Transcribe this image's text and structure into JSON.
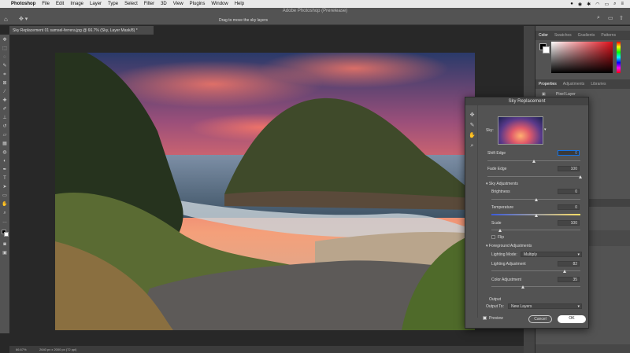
{
  "menubar": {
    "app": "Photoshop",
    "items": [
      "File",
      "Edit",
      "Image",
      "Layer",
      "Type",
      "Select",
      "Filter",
      "3D",
      "View",
      "Plugins",
      "Window",
      "Help"
    ]
  },
  "window": {
    "title": "Adobe Photoshop (Prerelease)",
    "hint": "Drag to move the sky layers"
  },
  "document": {
    "tab": "Sky Replacement 01 samsel-ferrera.jpg @ 66.7% (Sky, Layer Mask/8) *",
    "zoom": "66.67%",
    "size": "2640 px x 2000 px (72 ppi)"
  },
  "panels": {
    "top_tabs": [
      "Color",
      "Swatches",
      "Gradients",
      "Patterns"
    ],
    "mid_tabs": [
      "Properties",
      "Adjustments",
      "Libraries"
    ],
    "pixel_layer": "Pixel Layer"
  },
  "dialog": {
    "title": "Sky Replacement",
    "sky_label": "Sky:",
    "shift_edge": {
      "label": "Shift Edge",
      "value": "0",
      "level": 0.5
    },
    "fade_edge": {
      "label": "Fade Edge",
      "value": "100",
      "level": 1.0
    },
    "sky_adjustments": "Sky Adjustments",
    "brightness": {
      "label": "Brightness",
      "value": "0",
      "level": 0.5
    },
    "temperature": {
      "label": "Temperature",
      "value": "0",
      "level": 0.5
    },
    "scale": {
      "label": "Scale",
      "value": "100",
      "level": 0.1
    },
    "flip": "Flip",
    "foreground_adjustments": "Foreground Adjustments",
    "lighting_mode": {
      "label": "Lighting Mode:",
      "value": "Multiply"
    },
    "lighting_adjustment": {
      "label": "Lighting Adjustment",
      "value": "82",
      "level": 0.82
    },
    "color_adjustment": {
      "label": "Color Adjustment",
      "value": "35",
      "level": 0.35
    },
    "output": "Output",
    "output_to": {
      "label": "Output To:",
      "value": "New Layers"
    },
    "preview": "Preview",
    "cancel": "Cancel",
    "ok": "OK"
  },
  "colors": {
    "accent": "#1473e6",
    "panel": "#535353",
    "dark": "#282828"
  }
}
